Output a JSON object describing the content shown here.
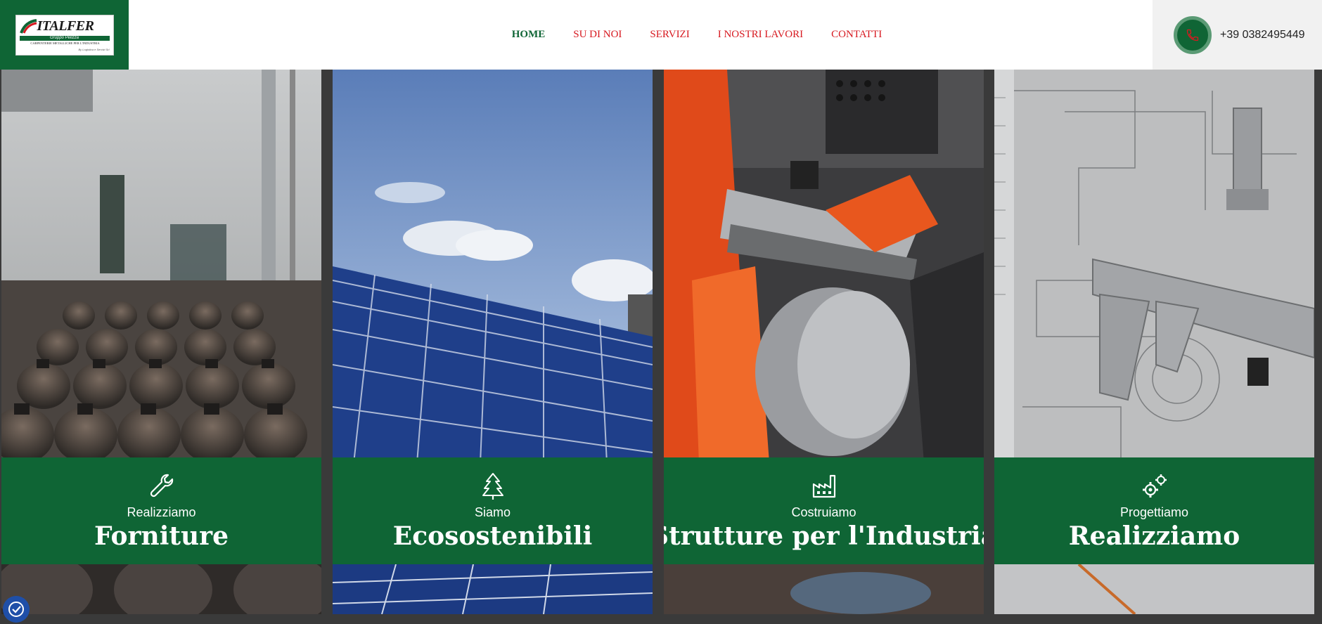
{
  "header": {
    "logo": {
      "name": "ITALFER",
      "group": "Gruppo Pelizza",
      "tagline": "CARPENTERIE METALLICHE PER L'INDUSTRIA",
      "tiny": "By Logistica e Servizi Srl"
    },
    "nav": [
      {
        "label": "HOME",
        "active": true
      },
      {
        "label": "SU DI NOI",
        "active": false
      },
      {
        "label": "SERVIZI",
        "active": false
      },
      {
        "label": "I NOSTRI LAVORI",
        "active": false
      },
      {
        "label": "CONTATTI",
        "active": false
      }
    ],
    "phone": "+39 0382495449"
  },
  "cards": [
    {
      "kicker": "Realizziamo",
      "title": "Forniture",
      "icon": "wrench-icon"
    },
    {
      "kicker": "Siamo",
      "title": "Ecosostenibili",
      "icon": "tree-icon"
    },
    {
      "kicker": "Costruiamo",
      "title": "Strutture per l'Industria",
      "icon": "factory-icon"
    },
    {
      "kicker": "Progettiamo",
      "title": "Realizziamo",
      "icon": "gears-icon"
    }
  ],
  "colors": {
    "brand_green": "#0f6535",
    "nav_red": "#d71920",
    "a11y_blue": "#1f4fa8"
  }
}
